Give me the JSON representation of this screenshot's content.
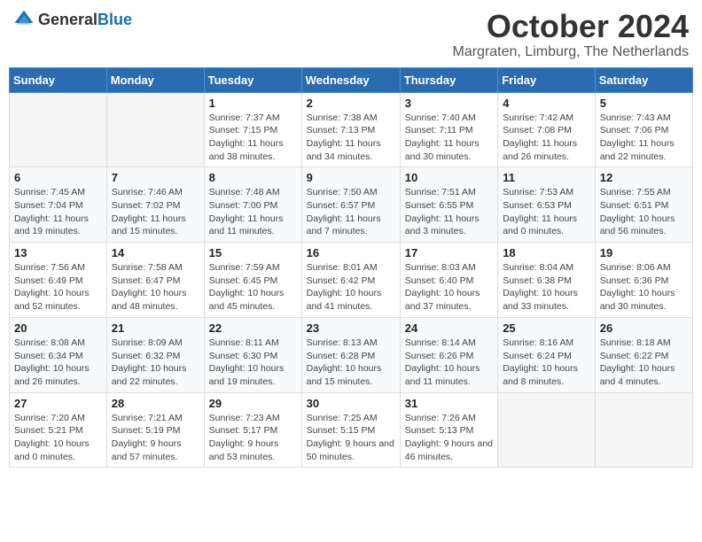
{
  "logo": {
    "text_general": "General",
    "text_blue": "Blue"
  },
  "header": {
    "month": "October 2024",
    "location": "Margraten, Limburg, The Netherlands"
  },
  "weekdays": [
    "Sunday",
    "Monday",
    "Tuesday",
    "Wednesday",
    "Thursday",
    "Friday",
    "Saturday"
  ],
  "weeks": [
    [
      {
        "day": "",
        "info": ""
      },
      {
        "day": "",
        "info": ""
      },
      {
        "day": "1",
        "info": "Sunrise: 7:37 AM\nSunset: 7:15 PM\nDaylight: 11 hours and 38 minutes."
      },
      {
        "day": "2",
        "info": "Sunrise: 7:38 AM\nSunset: 7:13 PM\nDaylight: 11 hours and 34 minutes."
      },
      {
        "day": "3",
        "info": "Sunrise: 7:40 AM\nSunset: 7:11 PM\nDaylight: 11 hours and 30 minutes."
      },
      {
        "day": "4",
        "info": "Sunrise: 7:42 AM\nSunset: 7:08 PM\nDaylight: 11 hours and 26 minutes."
      },
      {
        "day": "5",
        "info": "Sunrise: 7:43 AM\nSunset: 7:06 PM\nDaylight: 11 hours and 22 minutes."
      }
    ],
    [
      {
        "day": "6",
        "info": "Sunrise: 7:45 AM\nSunset: 7:04 PM\nDaylight: 11 hours and 19 minutes."
      },
      {
        "day": "7",
        "info": "Sunrise: 7:46 AM\nSunset: 7:02 PM\nDaylight: 11 hours and 15 minutes."
      },
      {
        "day": "8",
        "info": "Sunrise: 7:48 AM\nSunset: 7:00 PM\nDaylight: 11 hours and 11 minutes."
      },
      {
        "day": "9",
        "info": "Sunrise: 7:50 AM\nSunset: 6:57 PM\nDaylight: 11 hours and 7 minutes."
      },
      {
        "day": "10",
        "info": "Sunrise: 7:51 AM\nSunset: 6:55 PM\nDaylight: 11 hours and 3 minutes."
      },
      {
        "day": "11",
        "info": "Sunrise: 7:53 AM\nSunset: 6:53 PM\nDaylight: 11 hours and 0 minutes."
      },
      {
        "day": "12",
        "info": "Sunrise: 7:55 AM\nSunset: 6:51 PM\nDaylight: 10 hours and 56 minutes."
      }
    ],
    [
      {
        "day": "13",
        "info": "Sunrise: 7:56 AM\nSunset: 6:49 PM\nDaylight: 10 hours and 52 minutes."
      },
      {
        "day": "14",
        "info": "Sunrise: 7:58 AM\nSunset: 6:47 PM\nDaylight: 10 hours and 48 minutes."
      },
      {
        "day": "15",
        "info": "Sunrise: 7:59 AM\nSunset: 6:45 PM\nDaylight: 10 hours and 45 minutes."
      },
      {
        "day": "16",
        "info": "Sunrise: 8:01 AM\nSunset: 6:42 PM\nDaylight: 10 hours and 41 minutes."
      },
      {
        "day": "17",
        "info": "Sunrise: 8:03 AM\nSunset: 6:40 PM\nDaylight: 10 hours and 37 minutes."
      },
      {
        "day": "18",
        "info": "Sunrise: 8:04 AM\nSunset: 6:38 PM\nDaylight: 10 hours and 33 minutes."
      },
      {
        "day": "19",
        "info": "Sunrise: 8:06 AM\nSunset: 6:36 PM\nDaylight: 10 hours and 30 minutes."
      }
    ],
    [
      {
        "day": "20",
        "info": "Sunrise: 8:08 AM\nSunset: 6:34 PM\nDaylight: 10 hours and 26 minutes."
      },
      {
        "day": "21",
        "info": "Sunrise: 8:09 AM\nSunset: 6:32 PM\nDaylight: 10 hours and 22 minutes."
      },
      {
        "day": "22",
        "info": "Sunrise: 8:11 AM\nSunset: 6:30 PM\nDaylight: 10 hours and 19 minutes."
      },
      {
        "day": "23",
        "info": "Sunrise: 8:13 AM\nSunset: 6:28 PM\nDaylight: 10 hours and 15 minutes."
      },
      {
        "day": "24",
        "info": "Sunrise: 8:14 AM\nSunset: 6:26 PM\nDaylight: 10 hours and 11 minutes."
      },
      {
        "day": "25",
        "info": "Sunrise: 8:16 AM\nSunset: 6:24 PM\nDaylight: 10 hours and 8 minutes."
      },
      {
        "day": "26",
        "info": "Sunrise: 8:18 AM\nSunset: 6:22 PM\nDaylight: 10 hours and 4 minutes."
      }
    ],
    [
      {
        "day": "27",
        "info": "Sunrise: 7:20 AM\nSunset: 5:21 PM\nDaylight: 10 hours and 0 minutes."
      },
      {
        "day": "28",
        "info": "Sunrise: 7:21 AM\nSunset: 5:19 PM\nDaylight: 9 hours and 57 minutes."
      },
      {
        "day": "29",
        "info": "Sunrise: 7:23 AM\nSunset: 5:17 PM\nDaylight: 9 hours and 53 minutes."
      },
      {
        "day": "30",
        "info": "Sunrise: 7:25 AM\nSunset: 5:15 PM\nDaylight: 9 hours and 50 minutes."
      },
      {
        "day": "31",
        "info": "Sunrise: 7:26 AM\nSunset: 5:13 PM\nDaylight: 9 hours and 46 minutes."
      },
      {
        "day": "",
        "info": ""
      },
      {
        "day": "",
        "info": ""
      }
    ]
  ]
}
